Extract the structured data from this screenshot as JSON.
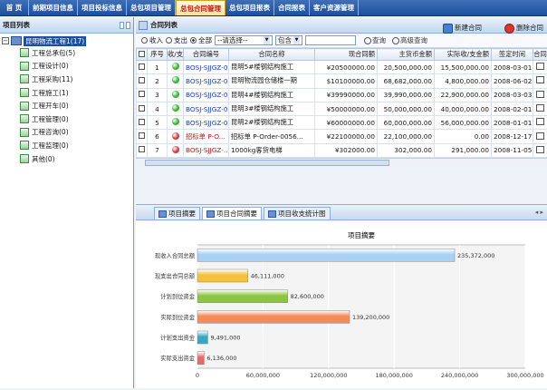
{
  "nav": {
    "items": [
      "首 页",
      "前期项目信息",
      "项目投标信息",
      "总包项目管理",
      "总包合同管理",
      "总包项目报表",
      "合同报表",
      "客户资源管理"
    ],
    "active_index": 4
  },
  "left_panel": {
    "title": "项目列表",
    "root_label": "昆明物流工程1(17)",
    "nodes": [
      "工程总承包(5)",
      "工程设计(0)",
      "工程采购(11)",
      "工程施工(1)",
      "工程开车(0)",
      "工程管理(0)",
      "工程咨询(0)",
      "工程监理(0)",
      "其他(0)"
    ]
  },
  "contract_list": {
    "title": "合同列表",
    "new_label": "新建合同",
    "delete_label": "删除合同",
    "filter": {
      "radios": [
        "收入",
        "支出",
        "全部"
      ],
      "selected_radio": "全部",
      "select_value": "--请选择--",
      "match_value": "包含",
      "search_label": "查询",
      "advanced_label": "高级查询"
    },
    "columns": [
      "",
      "序号",
      "收/支",
      "合同编号",
      "合同名称",
      "现合同额",
      "主货币金额",
      "实际收/支金额",
      "签定时间",
      "合同"
    ],
    "rows": [
      {
        "no": "1",
        "status": "green",
        "code": "BOSJ-SJJGZ-005",
        "name": "昆明5#楼钢结构施工",
        "amount": "¥20500000.00",
        "main": "20,500,000.00",
        "actual": "15,500,000.00",
        "date": "2008-03-01",
        "red": false
      },
      {
        "no": "2",
        "status": "green",
        "code": "BOSJ-SJJGZ-004",
        "name": "昆明物流园仓储楼一期",
        "amount": "$10100000.00",
        "main": "68,682,000.00",
        "actual": "4,800,000.00",
        "date": "2008-06-02",
        "red": false
      },
      {
        "no": "3",
        "status": "green",
        "code": "BOSJ-SJJGZ-003",
        "name": "昆明4#楼钢结构施工",
        "amount": "¥39990000.00",
        "main": "39,990,000.00",
        "actual": "22,900,000.00",
        "date": "2008-03-03",
        "red": false
      },
      {
        "no": "4",
        "status": "green",
        "code": "BOSJ-SJJGZ-002",
        "name": "昆明3#楼钢结构施工",
        "amount": "¥50000000.00",
        "main": "50,000,000.00",
        "actual": "40,000,000.00",
        "date": "2008-02-01",
        "red": false
      },
      {
        "no": "5",
        "status": "green",
        "code": "BOSJ-SJJGZ-001",
        "name": "昆明2#楼钢结构施工",
        "amount": "¥60000000.00",
        "main": "60,000,000.00",
        "actual": "56,000,000.00",
        "date": "2008-01-01",
        "red": false
      },
      {
        "no": "6",
        "status": "red",
        "code": "招标单 P-O...",
        "name": "招标单 P-Order-0056...",
        "amount": "¥22100000.00",
        "main": "22,100,000.00",
        "actual": "0.00",
        "date": "2008-12-17",
        "red": true
      },
      {
        "no": "7",
        "status": "red",
        "code": "BOSJ-SJJGZ-...",
        "name": "1000kg客货电梯",
        "amount": "¥302000.00",
        "main": "302,000.00",
        "actual": "291,000.00",
        "date": "2008-11-05",
        "red": true
      }
    ]
  },
  "tabs": [
    "项目摘要",
    "项目合同摘要",
    "项目收支统计图"
  ],
  "active_tab": 1,
  "chart_data": {
    "type": "bar",
    "orientation": "horizontal",
    "title": "项目摘要",
    "categories": [
      "现收入合同总额",
      "现支出合同总额",
      "计划到位资金",
      "实际到位资金",
      "计划支出资金",
      "实际支出资金"
    ],
    "values": [
      235372000,
      46111000,
      82600000,
      139200000,
      9491000,
      6136000
    ],
    "value_labels": [
      "235,372,000",
      "46,111,000",
      "82,600,000",
      "139,200,000",
      "9,491,000",
      "6,136,000"
    ],
    "xlim": [
      0,
      300000000
    ],
    "xticks": [
      0,
      60000000,
      120000000,
      180000000,
      240000000,
      300000000
    ],
    "xtick_labels": [
      "0",
      "60,000,000",
      "120,000,000",
      "180,000,000",
      "240,000,000",
      "300,000,000"
    ],
    "colors": [
      "#a9d0f5",
      "#f3c23a",
      "#8cc640",
      "#f58a5a",
      "#3aa6c2",
      "#e66a6a"
    ],
    "grid": true
  },
  "colors": {
    "nav_bg": "#1d4f9e",
    "active_text": "#c01818",
    "status_green": "#2fb62f",
    "status_red": "#d43a3a"
  }
}
